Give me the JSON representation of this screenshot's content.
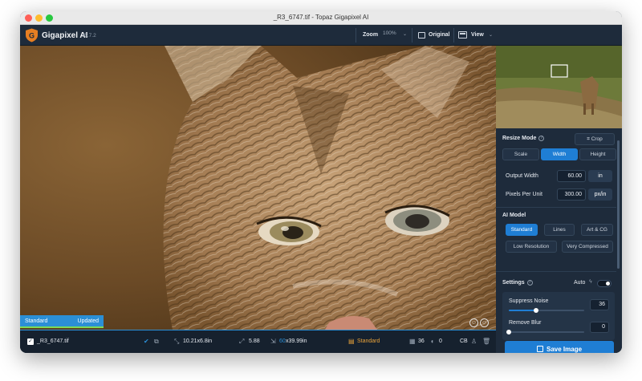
{
  "window": {
    "title": "_R3_6747.tif - Topaz Gigapixel AI"
  },
  "app": {
    "name": "Gigapixel AI",
    "version": "v5.7.2",
    "logo_letter": "G"
  },
  "header": {
    "zoom_label": "Zoom",
    "zoom_value": "100%",
    "original_label": "Original",
    "view_label": "View"
  },
  "preview": {
    "status_model": "Standard",
    "status_state": "Updated"
  },
  "bottom": {
    "filename": "_R3_6747.tif",
    "input_size": "10.21x6.8in",
    "scale": "5.88",
    "output_size_prefix": "60",
    "output_size_suffix": "x39.99in",
    "model": "Standard",
    "noise": "36",
    "blur": "0",
    "color_mode": "CB"
  },
  "sidebar": {
    "resize_mode_label": "Resize Mode",
    "crop_label": "Crop",
    "resize_tabs": [
      "Scale",
      "Width",
      "Height"
    ],
    "output_width_label": "Output Width",
    "output_width_value": "60.00",
    "output_width_unit": "in",
    "ppu_label": "Pixels Per Unit",
    "ppu_value": "300.00",
    "ppu_unit": "px/in",
    "ai_model_label": "AI Model",
    "models": [
      "Standard",
      "Lines",
      "Art & CG",
      "Low Resolution",
      "Very Compressed"
    ],
    "settings_label": "Settings",
    "auto_label": "Auto",
    "suppress_noise_label": "Suppress Noise",
    "suppress_noise_value": "36",
    "suppress_noise_level": 36,
    "remove_blur_label": "Remove Blur",
    "remove_blur_value": "0",
    "remove_blur_level": 0,
    "save_label": "Save Image"
  },
  "colors": {
    "accent": "#1f7ed4",
    "status_bar": "#2b8fd6",
    "status_progress": "#7ed957",
    "model_highlight": "#e8a23a",
    "logo_orange": "#e67e22"
  }
}
